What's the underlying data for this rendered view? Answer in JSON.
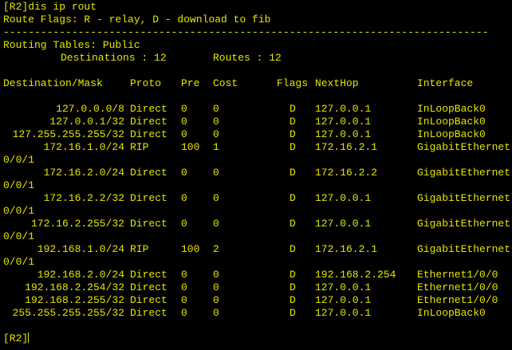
{
  "terminal": {
    "prompt_cmd": "[R2]dis ip rout",
    "flags_line": "Route Flags: R - relay, D - download to fib",
    "separator": "------------------------------------------------------------------------------",
    "tables_line": "Routing Tables: Public",
    "dest_label": "Destinations : 12",
    "routes_label": "Routes : 12",
    "headers": {
      "dest": "Destination/Mask",
      "proto": "Proto",
      "pre": "Pre",
      "cost": "Cost",
      "flags": "Flags",
      "nexthop": "NextHop",
      "iface": "Interface"
    },
    "routes": [
      {
        "dest": "127.0.0.0/8",
        "proto": "Direct",
        "pre": "0",
        "cost": "0",
        "flags": "D",
        "nexthop": "127.0.0.1",
        "iface": "InLoopBack0",
        "wrap": ""
      },
      {
        "dest": "127.0.0.1/32",
        "proto": "Direct",
        "pre": "0",
        "cost": "0",
        "flags": "D",
        "nexthop": "127.0.0.1",
        "iface": "InLoopBack0",
        "wrap": ""
      },
      {
        "dest": "127.255.255.255/32",
        "proto": "Direct",
        "pre": "0",
        "cost": "0",
        "flags": "D",
        "nexthop": "127.0.0.1",
        "iface": "InLoopBack0",
        "wrap": ""
      },
      {
        "dest": "172.16.1.0/24",
        "proto": "RIP",
        "pre": "100",
        "cost": "1",
        "flags": "D",
        "nexthop": "172.16.2.1",
        "iface": "GigabitEthernet",
        "wrap": "0/0/1"
      },
      {
        "dest": "172.16.2.0/24",
        "proto": "Direct",
        "pre": "0",
        "cost": "0",
        "flags": "D",
        "nexthop": "172.16.2.2",
        "iface": "GigabitEthernet",
        "wrap": "0/0/1"
      },
      {
        "dest": "172.16.2.2/32",
        "proto": "Direct",
        "pre": "0",
        "cost": "0",
        "flags": "D",
        "nexthop": "127.0.0.1",
        "iface": "GigabitEthernet",
        "wrap": "0/0/1"
      },
      {
        "dest": "172.16.2.255/32",
        "proto": "Direct",
        "pre": "0",
        "cost": "0",
        "flags": "D",
        "nexthop": "127.0.0.1",
        "iface": "GigabitEthernet",
        "wrap": "0/0/1"
      },
      {
        "dest": "192.168.1.0/24",
        "proto": "RIP",
        "pre": "100",
        "cost": "2",
        "flags": "D",
        "nexthop": "172.16.2.1",
        "iface": "GigabitEthernet",
        "wrap": "0/0/1"
      },
      {
        "dest": "192.168.2.0/24",
        "proto": "Direct",
        "pre": "0",
        "cost": "0",
        "flags": "D",
        "nexthop": "192.168.2.254",
        "iface": "Ethernet1/0/0",
        "wrap": ""
      },
      {
        "dest": "192.168.2.254/32",
        "proto": "Direct",
        "pre": "0",
        "cost": "0",
        "flags": "D",
        "nexthop": "127.0.0.1",
        "iface": "Ethernet1/0/0",
        "wrap": ""
      },
      {
        "dest": "192.168.2.255/32",
        "proto": "Direct",
        "pre": "0",
        "cost": "0",
        "flags": "D",
        "nexthop": "127.0.0.1",
        "iface": "Ethernet1/0/0",
        "wrap": ""
      },
      {
        "dest": "255.255.255.255/32",
        "proto": "Direct",
        "pre": "0",
        "cost": "0",
        "flags": "D",
        "nexthop": "127.0.0.1",
        "iface": "InLoopBack0",
        "wrap": ""
      }
    ],
    "final_prompt": "[R2]"
  }
}
